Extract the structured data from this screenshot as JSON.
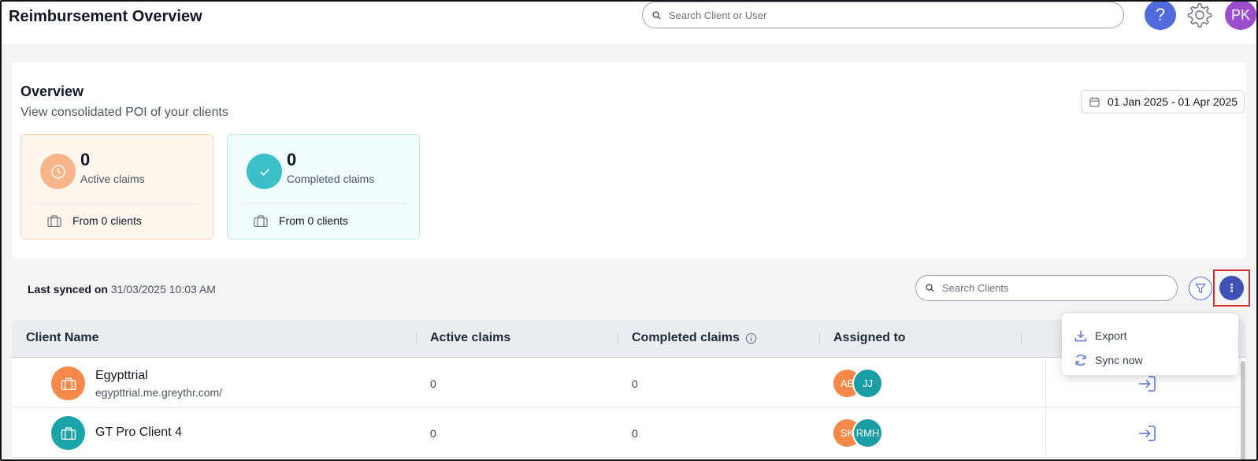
{
  "header": {
    "title": "Reimbursement Overview",
    "search_placeholder": "Search Client or User",
    "help_label": "?",
    "user_initials": "PK"
  },
  "overview": {
    "title": "Overview",
    "subtitle": "View consolidated POI of your clients",
    "date_range": "01 Jan 2025 - 01 Apr 2025",
    "stats": [
      {
        "count": "0",
        "label": "Active claims",
        "footer": "From 0 clients",
        "icon": "clock-icon",
        "color": "#f9b58a"
      },
      {
        "count": "0",
        "label": "Completed claims",
        "footer": "From 0 clients",
        "icon": "check-icon",
        "color": "#3bbfc9"
      }
    ]
  },
  "sync": {
    "label": "Last synced on",
    "value": "31/03/2025 10:03 AM"
  },
  "toolbar": {
    "search_placeholder": "Search Clients",
    "more_label": "⋮"
  },
  "menu": {
    "items": [
      {
        "label": "Export",
        "icon": "download-icon"
      },
      {
        "label": "Sync now",
        "icon": "sync-icon"
      }
    ]
  },
  "table": {
    "columns": [
      "Client Name",
      "Active claims",
      "Completed claims",
      "Assigned to"
    ],
    "rows": [
      {
        "name": "Egypttrial",
        "domain": "egypttrial.me.greythr.com/",
        "active": "0",
        "completed": "0",
        "icon_color": "#f5894a",
        "assignees": [
          {
            "initials": "AE",
            "color": "#f5894a"
          },
          {
            "initials": "JJ",
            "color": "#1a9ea3"
          }
        ]
      },
      {
        "name": "GT Pro Client 4",
        "domain": "",
        "active": "0",
        "completed": "0",
        "icon_color": "#1aa3a8",
        "assignees": [
          {
            "initials": "SK",
            "color": "#f5894a"
          },
          {
            "initials": "RMH",
            "color": "#1a9ea3"
          }
        ]
      }
    ]
  }
}
